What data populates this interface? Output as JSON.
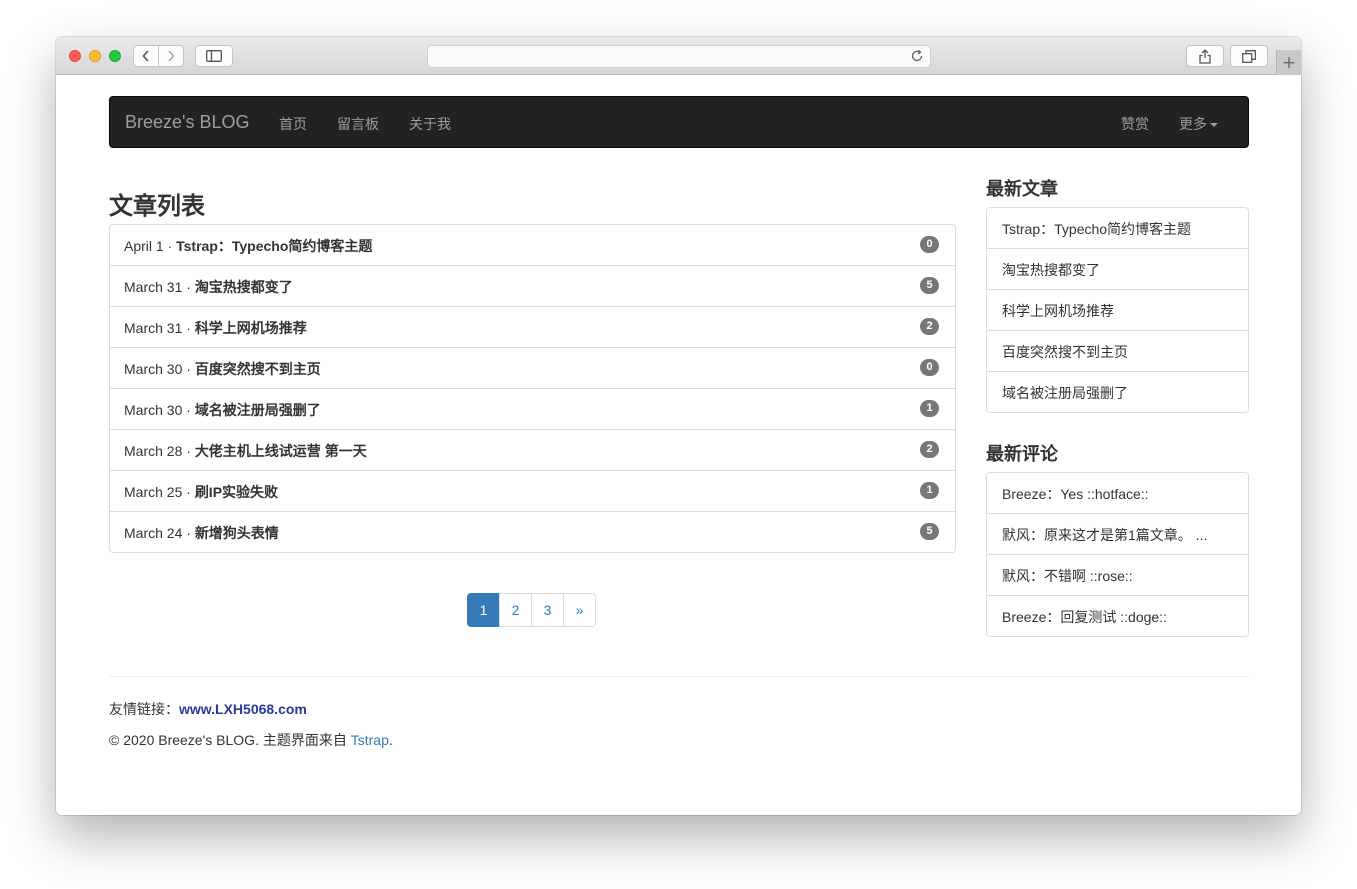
{
  "browser": {
    "buttons": [
      "back",
      "forward",
      "sidebar",
      "share",
      "tabs",
      "new-tab"
    ],
    "new_tab_symbol": "+"
  },
  "navbar": {
    "brand": "Breeze's BLOG",
    "links": [
      "首页",
      "留言板",
      "关于我"
    ],
    "right_links": [
      "赞赏",
      "更多"
    ]
  },
  "main": {
    "title": "文章列表",
    "posts": [
      {
        "date": "April 1 · ",
        "title": "Tstrap：Typecho简约博客主题",
        "comments": "0"
      },
      {
        "date": "March 31 · ",
        "title": "淘宝热搜都变了",
        "comments": "5"
      },
      {
        "date": "March 31 · ",
        "title": "科学上网机场推荐",
        "comments": "2"
      },
      {
        "date": "March 30 · ",
        "title": "百度突然搜不到主页",
        "comments": "0"
      },
      {
        "date": "March 30 · ",
        "title": "域名被注册局强删了",
        "comments": "1"
      },
      {
        "date": "March 28 · ",
        "title": "大佬主机上线试运营 第一天",
        "comments": "2"
      },
      {
        "date": "March 25 · ",
        "title": "刷IP实验失败",
        "comments": "1"
      },
      {
        "date": "March 24 · ",
        "title": "新增狗头表情",
        "comments": "5"
      }
    ],
    "pagination": [
      "1",
      "2",
      "3",
      "»"
    ],
    "current_page": "1"
  },
  "sidebar": {
    "recent_posts_title": "最新文章",
    "recent_posts": [
      "Tstrap：Typecho简约博客主题",
      "淘宝热搜都变了",
      "科学上网机场推荐",
      "百度突然搜不到主页",
      "域名被注册局强删了"
    ],
    "recent_comments_title": "最新评论",
    "recent_comments": [
      "Breeze：Yes ::hotface::",
      "默风：原来这才是第1篇文章。 ...",
      "默风：不错啊 ::rose::",
      "Breeze：回复测试 ::doge::"
    ]
  },
  "footer": {
    "friend_label": "友情链接：",
    "friend_link": "www.LXH5068.com",
    "copyright_prefix": "© 2020 Breeze's BLOG.  主题界面来自 ",
    "theme_link": "Tstrap",
    "copyright_suffix": "."
  },
  "colors": {
    "navbar_bg": "#222222",
    "link": "#337ab7",
    "badge": "#777777",
    "friend_link": "#2b3a9a"
  }
}
